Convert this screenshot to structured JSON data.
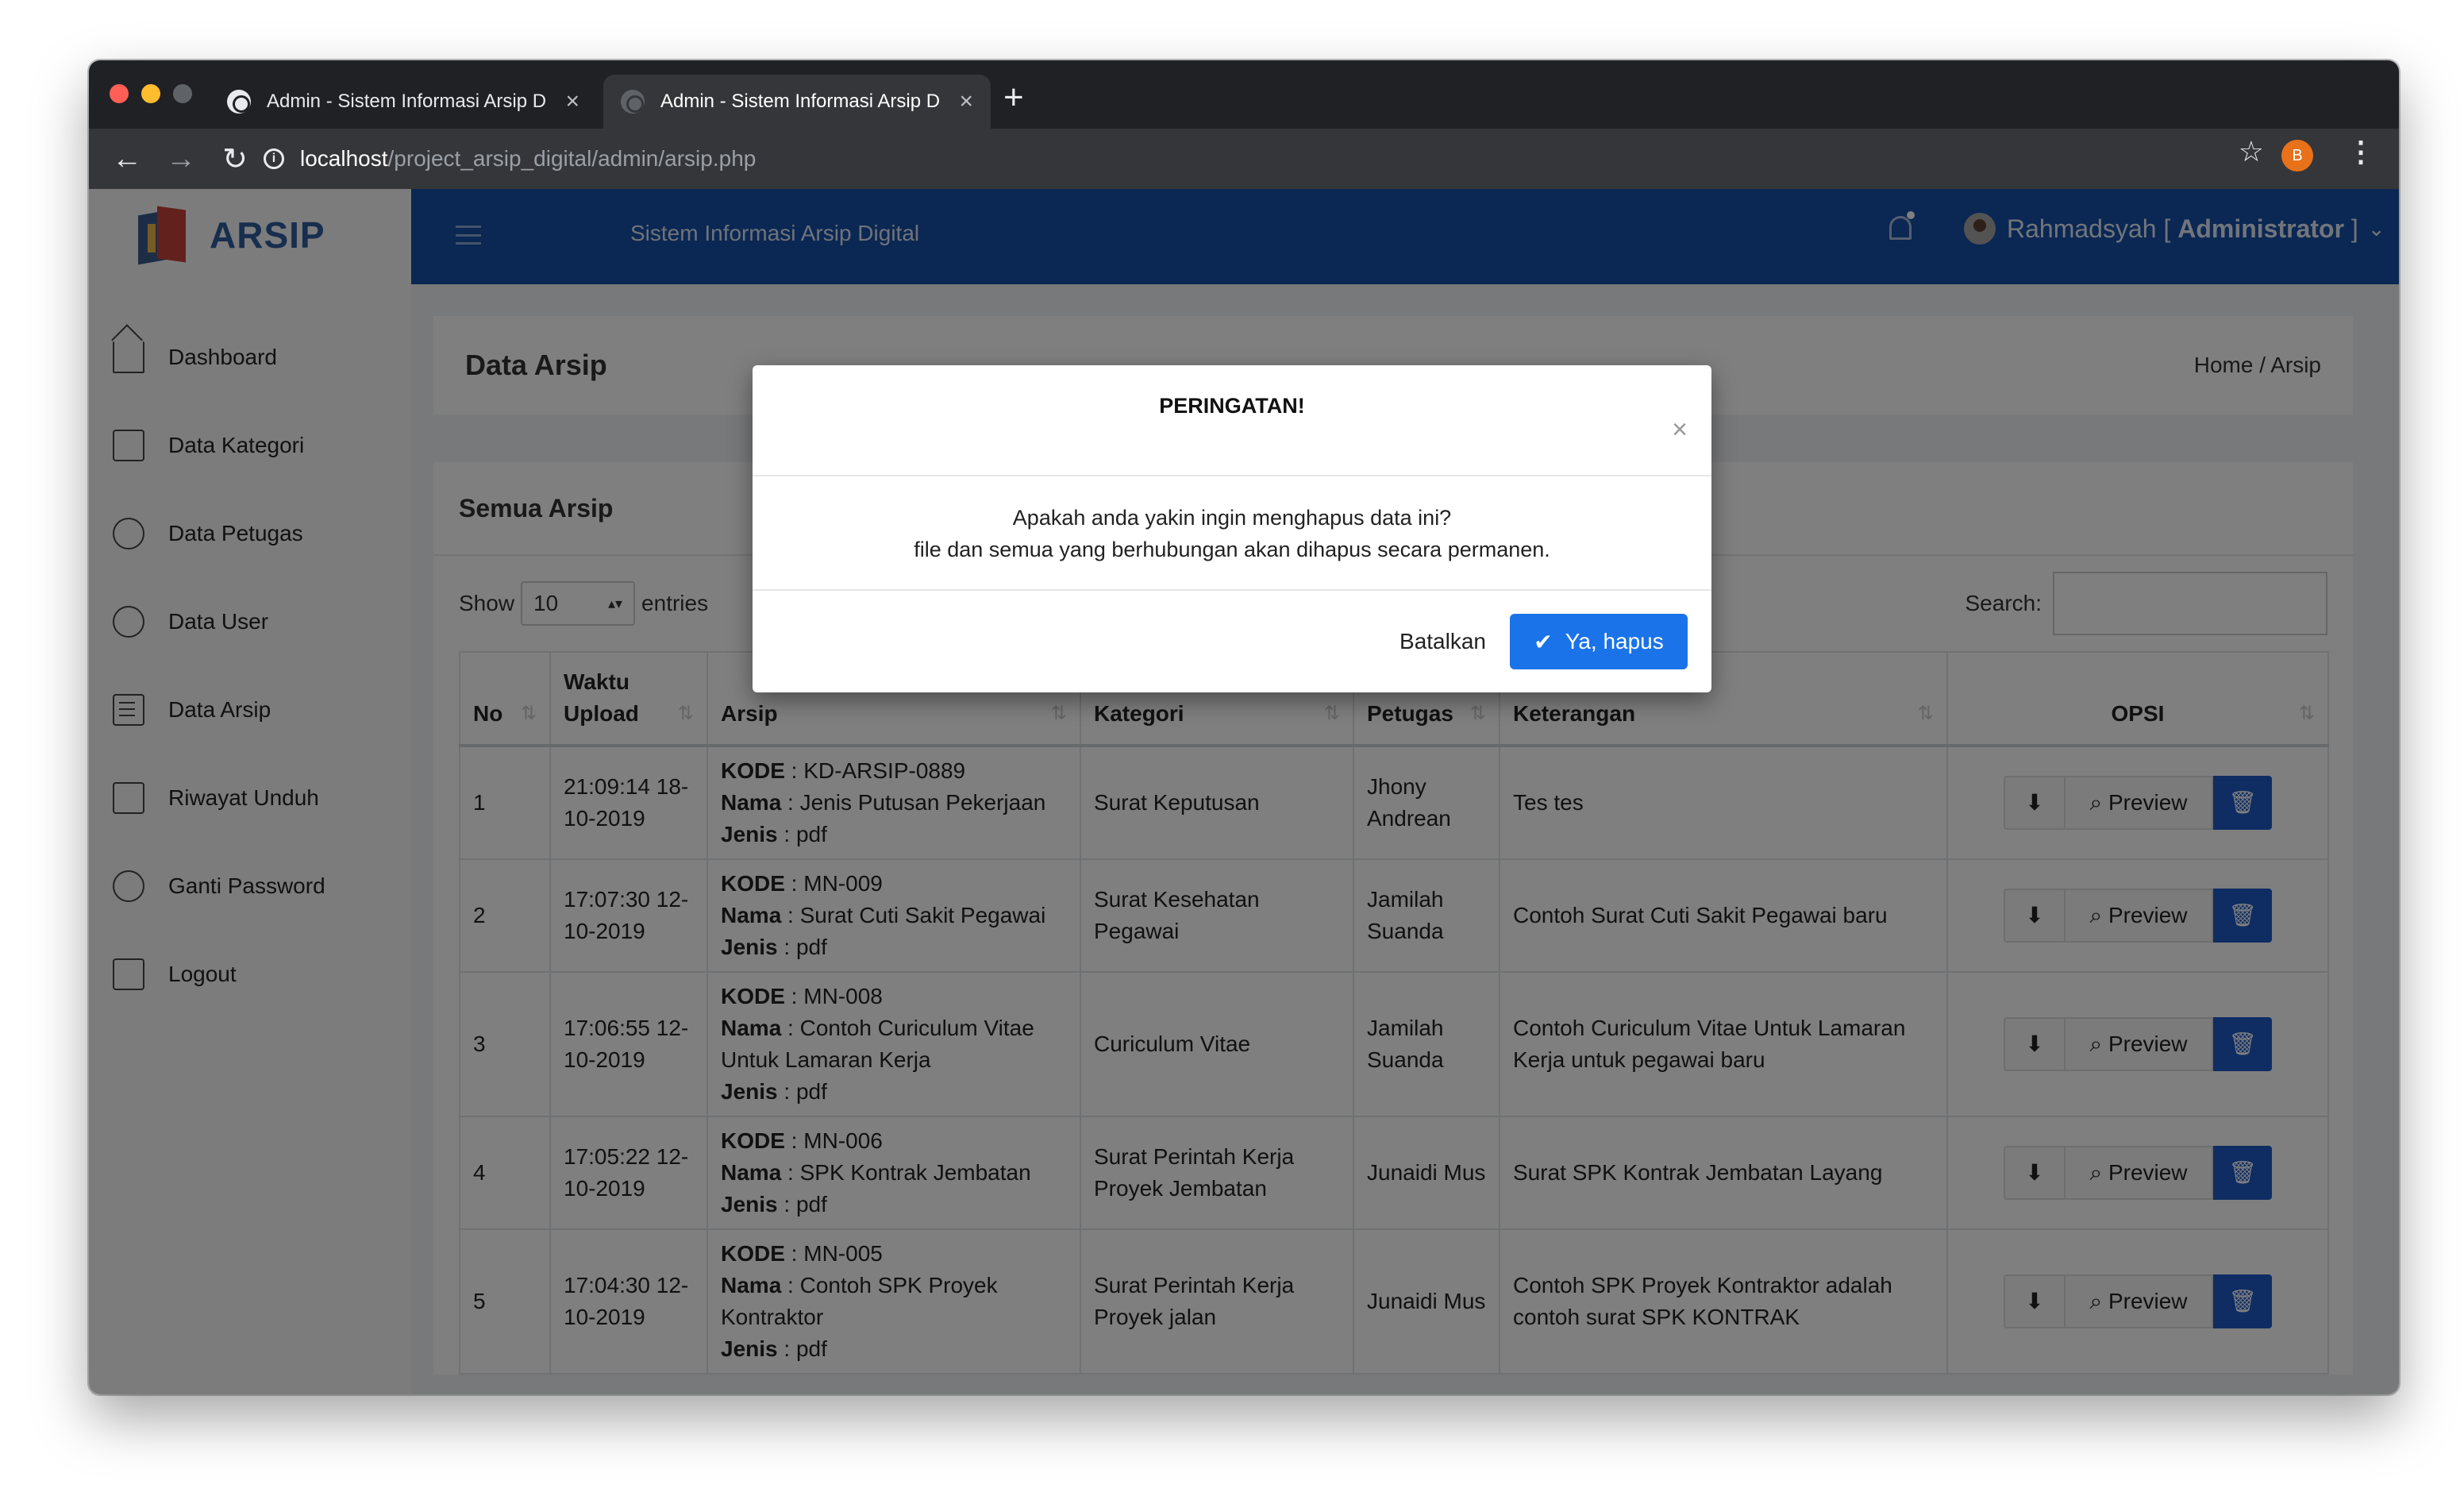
{
  "browser": {
    "tabs": [
      {
        "label": "Admin - Sistem Informasi Arsip D",
        "active": false
      },
      {
        "label": "Admin - Sistem Informasi Arsip D",
        "active": true
      }
    ],
    "url_host": "localhost",
    "url_path": "/project_arsip_digital/admin/arsip.php",
    "profile_initial": "B"
  },
  "brand": {
    "name": "ARSIP"
  },
  "header": {
    "site_title": "Sistem Informasi Arsip Digital",
    "user_name": "Rahmadsyah",
    "user_role_open": "[",
    "user_role": "Administrator",
    "user_role_close": "]"
  },
  "sidebar": {
    "items": [
      {
        "label": "Dashboard",
        "icon": "home-icon"
      },
      {
        "label": "Data Kategori",
        "icon": "folder-icon"
      },
      {
        "label": "Data Petugas",
        "icon": "officer-icon"
      },
      {
        "label": "Data User",
        "icon": "user-icon"
      },
      {
        "label": "Data Arsip",
        "icon": "file-icon"
      },
      {
        "label": "Riwayat Unduh",
        "icon": "archive-icon"
      },
      {
        "label": "Ganti Password",
        "icon": "flame-icon"
      },
      {
        "label": "Logout",
        "icon": "logout-icon"
      }
    ]
  },
  "page": {
    "title": "Data Arsip",
    "breadcrumb": "Home / Arsip"
  },
  "card": {
    "title": "Semua Arsip",
    "show_label": "Show",
    "entries_value": "10",
    "entries_label": "entries",
    "search_label": "Search:"
  },
  "table": {
    "headers": [
      "No",
      "Waktu Upload",
      "Arsip",
      "Kategori",
      "Petugas",
      "Keterangan",
      "OPSI"
    ],
    "preview_label": "Preview",
    "rows": [
      {
        "no": "1",
        "waktu": "21:09:14 18-10-2019",
        "kode": "KD-ARSIP-0889",
        "nama": "Jenis Putusan Pekerjaan",
        "jenis": "pdf",
        "kategori": "Surat Keputusan",
        "petugas": "Jhony Andrean",
        "keterangan": "Tes tes"
      },
      {
        "no": "2",
        "waktu": "17:07:30 12-10-2019",
        "kode": "MN-009",
        "nama": "Surat Cuti Sakit Pegawai",
        "jenis": "pdf",
        "kategori": "Surat Kesehatan Pegawai",
        "petugas": "Jamilah Suanda",
        "keterangan": "Contoh Surat Cuti Sakit Pegawai baru"
      },
      {
        "no": "3",
        "waktu": "17:06:55 12-10-2019",
        "kode": "MN-008",
        "nama": "Contoh Curiculum Vitae Untuk Lamaran Kerja",
        "jenis": "pdf",
        "kategori": "Curiculum Vitae",
        "petugas": "Jamilah Suanda",
        "keterangan": "Contoh Curiculum Vitae Untuk Lamaran Kerja untuk pegawai baru"
      },
      {
        "no": "4",
        "waktu": "17:05:22 12-10-2019",
        "kode": "MN-006",
        "nama": "SPK Kontrak Jembatan",
        "jenis": "pdf",
        "kategori": "Surat Perintah Kerja Proyek Jembatan",
        "petugas": "Junaidi Mus",
        "keterangan": "Surat SPK Kontrak Jembatan Layang"
      },
      {
        "no": "5",
        "waktu": "17:04:30 12-10-2019",
        "kode": "MN-005",
        "nama": "Contoh SPK Proyek Kontraktor",
        "jenis": "pdf",
        "kategori": "Surat Perintah Kerja Proyek jalan",
        "petugas": "Junaidi Mus",
        "keterangan": "Contoh SPK Proyek Kontraktor adalah contoh surat SPK KONTRAK"
      }
    ]
  },
  "modal": {
    "title": "PERINGATAN!",
    "line1": "Apakah anda yakin ingin menghapus data ini?",
    "line2": "file dan semua yang berhubungan akan dihapus secara permanen.",
    "cancel_label": "Batalkan",
    "confirm_label": "Ya, hapus"
  },
  "colors": {
    "header_blue": "#174ea6",
    "primary_button": "#1a73e8",
    "brand": "#2f5c9c"
  }
}
